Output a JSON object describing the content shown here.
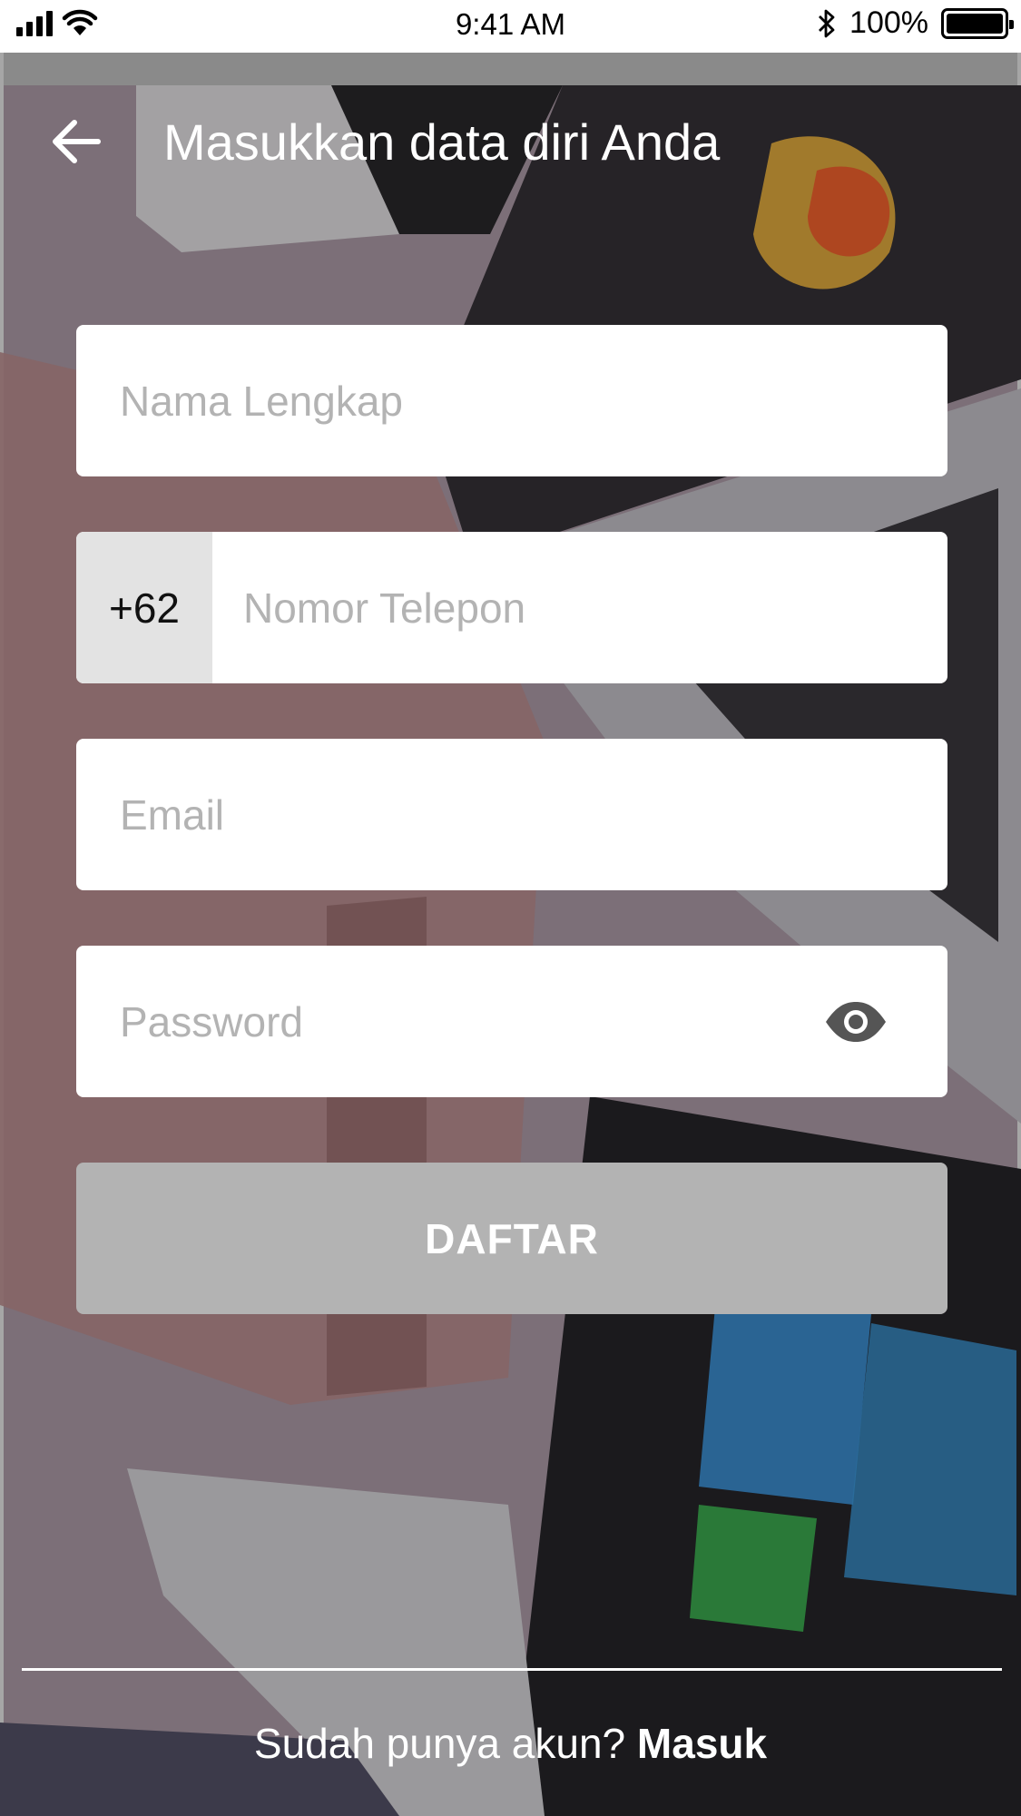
{
  "status_bar": {
    "time": "9:41 AM",
    "battery_percent": "100%",
    "icons": [
      "signal-icon",
      "wifi-icon",
      "bluetooth-icon",
      "battery-icon"
    ]
  },
  "header": {
    "title": "Masukkan data diri Anda",
    "back_icon": "arrow-left-icon"
  },
  "form": {
    "full_name": {
      "placeholder": "Nama Lengkap",
      "value": ""
    },
    "phone": {
      "country_code": "+62",
      "placeholder": "Nomor Telepon",
      "value": ""
    },
    "email": {
      "placeholder": "Email",
      "value": ""
    },
    "password": {
      "placeholder": "Password",
      "value": "",
      "toggle_icon": "eye-icon"
    },
    "submit_label": "DAFTAR"
  },
  "footer": {
    "prompt_text": "Sudah punya akun? ",
    "login_label": "Masuk"
  },
  "colors": {
    "overlay": "#7c6f78",
    "field_background": "#ffffff",
    "placeholder": "#b3b3b3",
    "prefix_background": "#e3e3e3",
    "button_disabled": "#b3b3b3",
    "text_light": "#ffffff"
  }
}
